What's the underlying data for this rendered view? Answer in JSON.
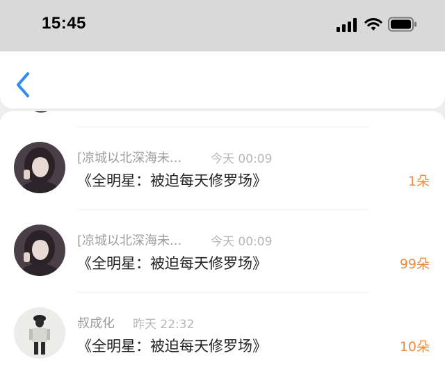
{
  "status_bar": {
    "time": "15:45",
    "icons": [
      "signal-icon",
      "wifi-icon",
      "battery-icon"
    ]
  },
  "nav": {
    "back_icon": "chevron-left-icon",
    "accent_color": "#2f8ef0"
  },
  "gifts": [
    {
      "user": "[凉城以北深海未...",
      "time": "今天 00:09",
      "book": "《全明星：被迫每天修罗场》",
      "count": "1朵",
      "avatar_icon": "avatar-girl-dark"
    },
    {
      "user": "[凉城以北深海未...",
      "time": "今天 00:09",
      "book": "《全明星：被迫每天修罗场》",
      "count": "99朵",
      "avatar_icon": "avatar-girl-dark"
    },
    {
      "user": "叔成化",
      "time": "昨天 22:32",
      "book": "《全明星：被迫每天修罗场》",
      "count": "10朵",
      "avatar_icon": "avatar-figure-light"
    }
  ],
  "colors": {
    "count": "#ef8a3c",
    "name": "#9c9c9c",
    "title": "#222222"
  }
}
